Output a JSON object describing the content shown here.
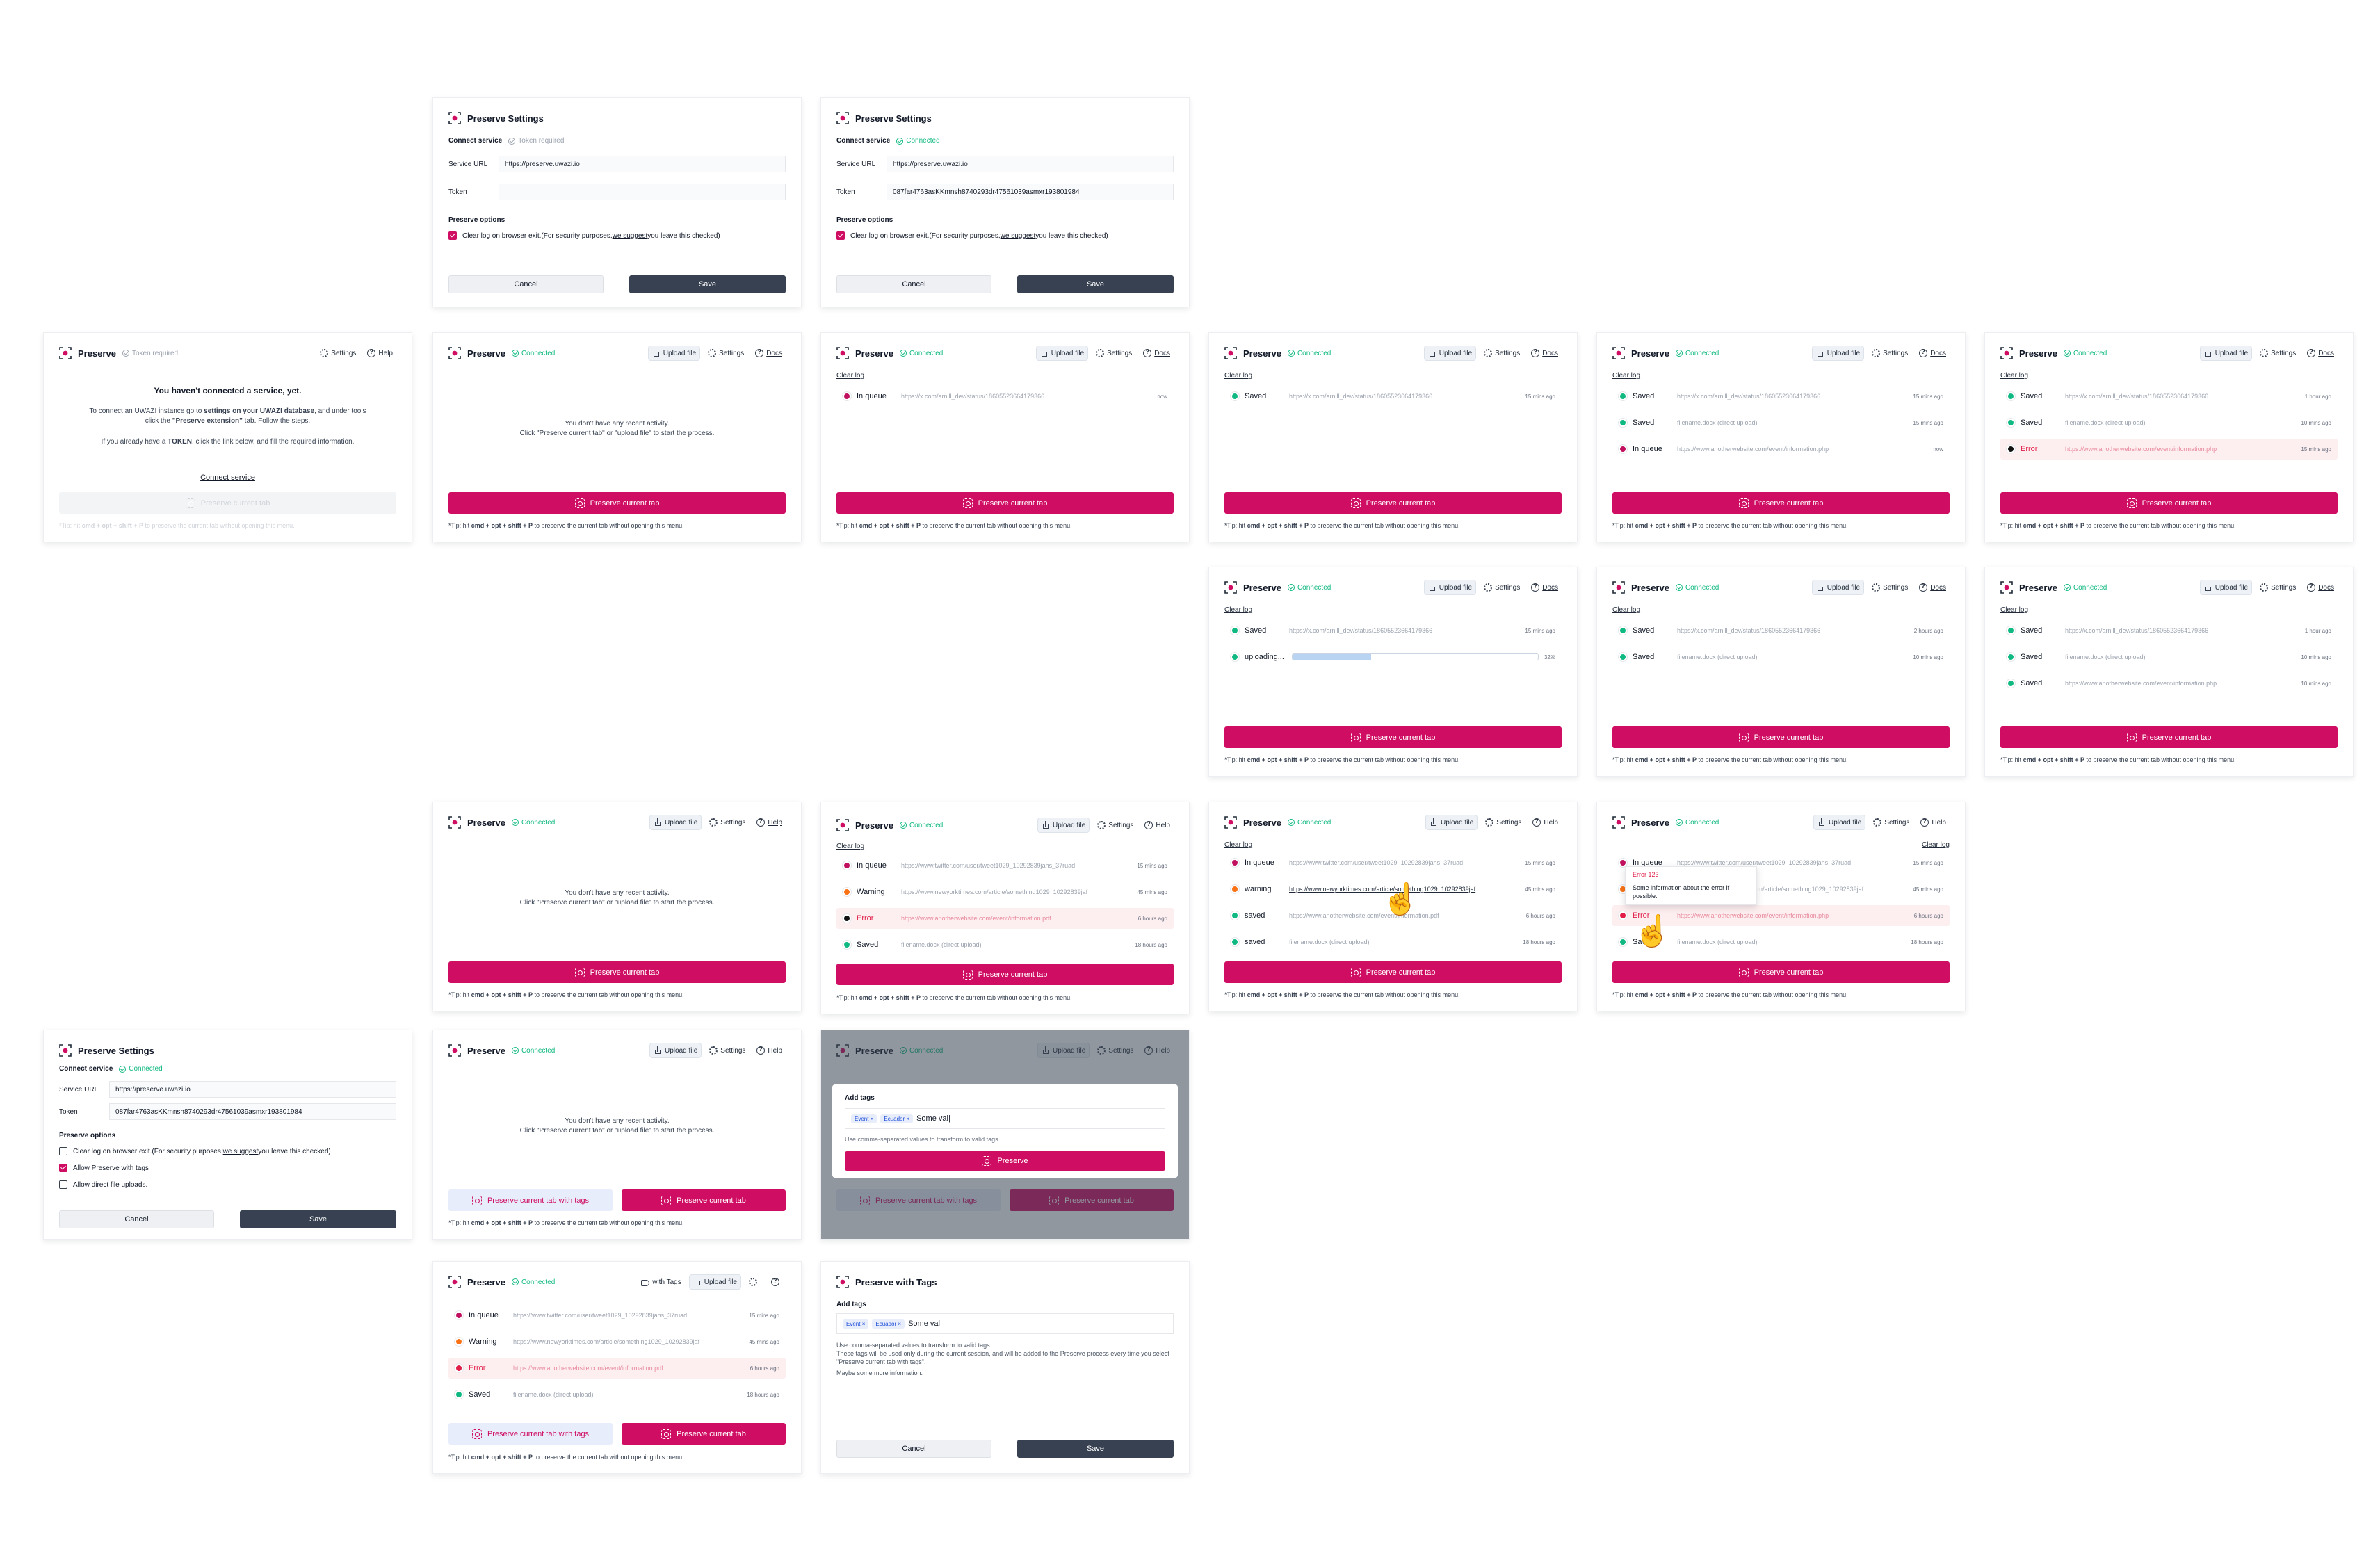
{
  "brand": {
    "accent": "#cf0d63",
    "connected": "#10b981",
    "dark_button": "#374151"
  },
  "title": "Preserve",
  "settings_title": "Preserve Settings",
  "with_tags_title": "Preserve with Tags",
  "status": {
    "connected": "Connected",
    "token_required": "Token required"
  },
  "header": {
    "upload": "Upload file",
    "settings": "Settings",
    "help": "Help",
    "docs": "Docs",
    "with_tags": "with Tags"
  },
  "clear_log": "Clear log",
  "preserve_btn": "Preserve current tab",
  "preserve_tags_btn": "Preserve current tab with tags",
  "preserve_single": "Preserve",
  "tip": {
    "pre": "*Tip: hit ",
    "keys": "cmd + opt + shift + P",
    "post": " to preserve the current tab without opening this menu."
  },
  "empty": {
    "line1": "You don't have any recent activity.",
    "line2": "Click \"Preserve current tab\" or \"upload file\" to start the process."
  },
  "not_connected": {
    "heading": "You haven't connected a service, yet.",
    "p1a": "To connect an UWAZI instance go to ",
    "p1b": "settings on your UWAZI database",
    "p1c": ", and under tools",
    "p1d": "click the ",
    "p1e": "\"Preserve extension\"",
    "p1f": " tab. Follow the steps.",
    "p2a": "If you already have a ",
    "p2b": "TOKEN",
    "p2c": ", click the link below, and fill the required information.",
    "link": "Connect service"
  },
  "form": {
    "connect": "Connect service",
    "service_url": "Service URL",
    "token": "Token",
    "url_value": "https://preserve.uwazi.io",
    "token_value": "087far4763asKKmnsh8740293dr47561039asmxr193801984",
    "options": "Preserve options",
    "clear_a": "Clear log on browser exit. ",
    "clear_b": "(For security purposes, ",
    "clear_c": "we suggest",
    "clear_d": " you leave this checked)",
    "allow_tags": "Allow Preserve with tags",
    "allow_upload": "Allow direct file uploads.",
    "cancel": "Cancel",
    "save": "Save"
  },
  "tags": {
    "label": "Add tags",
    "chips": [
      "Event",
      "Ecuador"
    ],
    "input": "Some val",
    "help": "Use comma-separated values to transform to valid tags.",
    "help2": "These tags will be used only during the current session, and will be added to the Preserve process every time you select \"Preserve current tab with tags\".",
    "help3": "Maybe some more information."
  },
  "states": {
    "queue": "In queue",
    "saved": "Saved",
    "warning": "Warning",
    "error": "Error",
    "uploading": "uploading...",
    "warning_lc": "warning",
    "saved_lc": "saved"
  },
  "urls": {
    "x": "https://x.com/arnill_dev/status/18605523664179366",
    "doc": "filename.docx (direct upload)",
    "php": "https://www.anotherwebsite.com/event/information.php",
    "pdf": "https://www.anotherwebsite.com/event/information.pdf",
    "tw": "https://www.twitter.com/user/tweet1029_10292839jahs_37ruad",
    "nyt": "https://www.newyorktimes.com/article/something1029_10292839jaf"
  },
  "times": {
    "now": "now",
    "m15": "15 mins ago",
    "m45": "45 mins ago",
    "m10": "10 mins ago",
    "h1": "1 hour ago",
    "h2": "2 hours ago",
    "h6": "6 hours ago",
    "h18": "18 hours ago"
  },
  "progress": {
    "percent": 32,
    "label": "32%"
  },
  "error_pop": {
    "title": "Error 123",
    "text": "Some information about the error if possible."
  }
}
